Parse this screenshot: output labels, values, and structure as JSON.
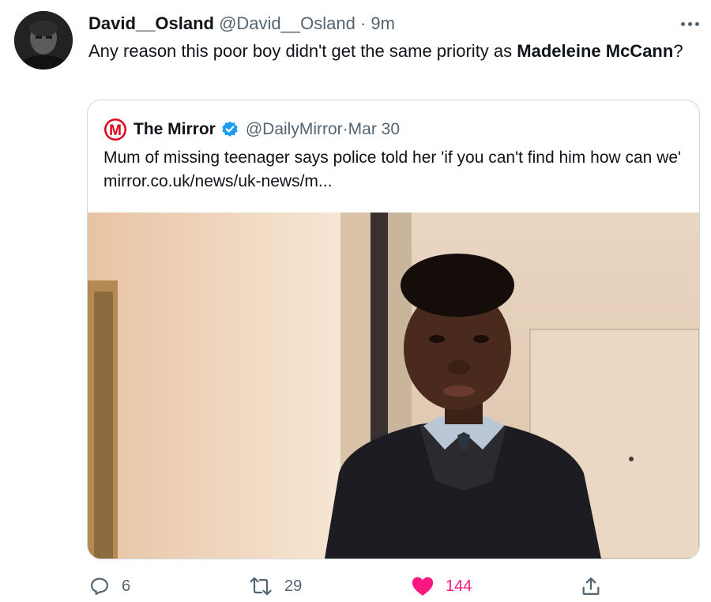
{
  "tweet": {
    "display_name": "David__Osland",
    "handle": "@David__Osland",
    "separator": " · ",
    "time": "9m",
    "text_before": "Any reason this poor boy didn't get the same priority as ",
    "text_bold": "Madeleine McCann",
    "text_after": "?"
  },
  "quote": {
    "display_name": "The Mirror",
    "handle": "@DailyMirror",
    "separator": " · ",
    "date": "Mar 30",
    "text": "Mum of missing teenager says police told her 'if you can't find him how can we' mirror.co.uk/news/uk-news/m...",
    "logo_letter": "M"
  },
  "actions": {
    "replies": "6",
    "retweets": "29",
    "likes": "144"
  },
  "colors": {
    "accent_blue": "#1d9bf0",
    "like_pink": "#f91880",
    "mirror_red": "#e2001a",
    "muted_text": "#536471"
  }
}
